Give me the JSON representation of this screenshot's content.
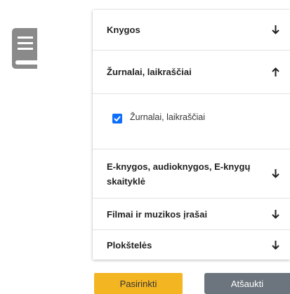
{
  "accordion": {
    "sections": [
      {
        "label": "Knygos",
        "state": "collapsed"
      },
      {
        "label": "Žurnalai, laikraščiai",
        "state": "expanded"
      },
      {
        "label": "E-knygos, audioknygos, E-knygų skaityklė",
        "state": "collapsed"
      },
      {
        "label": "Filmai ir muzikos įrašai",
        "state": "collapsed"
      },
      {
        "label": "Plokštelės",
        "state": "collapsed"
      }
    ],
    "expanded_option": {
      "label": "Žurnalai, laikraščiai",
      "checked": true
    }
  },
  "buttons": {
    "select_label": "Pasirinkti",
    "cancel_label": "Atšaukti"
  },
  "colors": {
    "checkbox": "#0d6efd",
    "select_button": "#f4b523",
    "cancel_button": "#6c757d",
    "icon": "#8a8a8a"
  },
  "icons": {
    "category": "book-icon",
    "collapsed": "arrow-down-icon",
    "expanded": "arrow-up-icon"
  }
}
